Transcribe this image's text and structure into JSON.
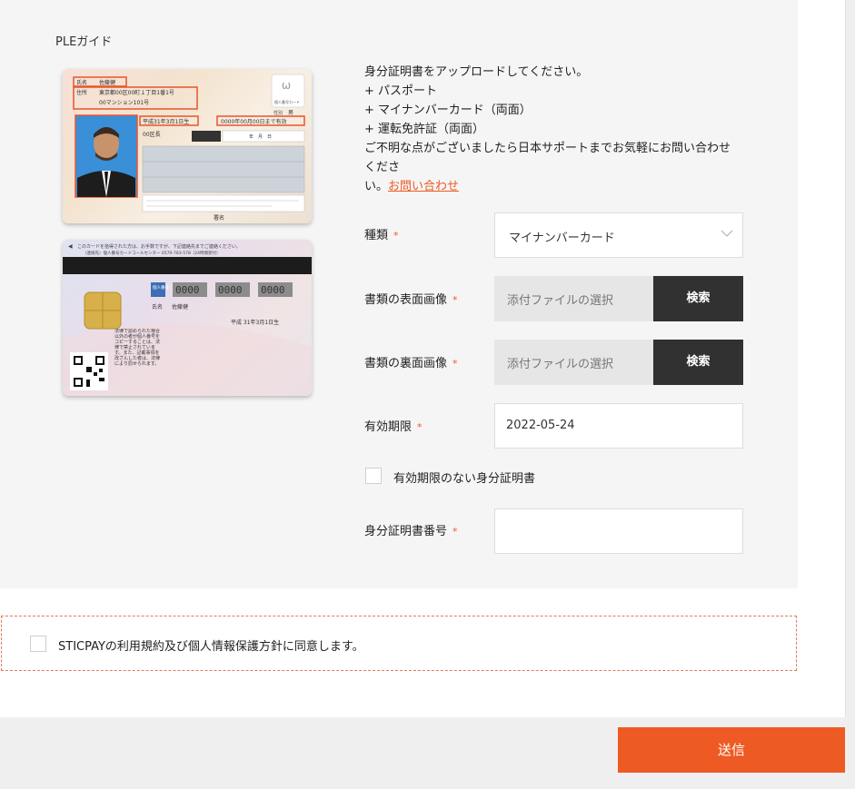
{
  "guide": {
    "title": "PLEガイド"
  },
  "card_front": {
    "name_label": "氏名",
    "name": "佐藤健",
    "address_label": "住所",
    "address_line1": "東京都00区00町１丁目1番1号",
    "address_line2": "00マンション101号",
    "birth": "平成31年3月1日生",
    "expiry": "0000年00月00日まで有効",
    "gender_label": "性別",
    "gender": "男",
    "ward": "00区長",
    "ym_d": "年　月　日",
    "signature": "署名",
    "mynumber_badge": "個人番号カード"
  },
  "card_back": {
    "notice": "このカードを拾得された方は、お手数ですが、下記連絡先までご連絡ください。",
    "contact": "（連絡先）個人番号カードコールセンター 0570-783-578（24時間受付）",
    "number_label": "個人番号",
    "number_blocks": [
      "0000",
      "0000",
      "0000"
    ],
    "name_label": "氏名",
    "name": "佐藤健",
    "birth": "平成 31年3月1日生",
    "legal_text": "法律で認められた場合以外の者が個人番号をコピーすることは、法律で禁止されています。また、記載事項を改ざんした者は、法律により罰せられます。"
  },
  "intro": {
    "line1": "身分証明書をアップロードしてください。",
    "line2": "+ パスポート",
    "line3": "+ マイナンバーカード（両面）",
    "line4": "+ 運転免許証（両面）",
    "line5": "ご不明な点がございましたら日本サポートまでお気軽にお問い合わせくださ",
    "line6_prefix": "い。",
    "contact_link": "お問い合わせ"
  },
  "form": {
    "required_mark": "*",
    "type_label": "種類",
    "type_value": "マイナンバーカード",
    "front_label": "書類の表面画像",
    "front_placeholder": "添付ファイルの選択",
    "front_button": "検索",
    "back_label": "書類の裏面画像",
    "back_placeholder": "添付ファイルの選択",
    "back_button": "検索",
    "expiry_label": "有効期限",
    "expiry_value": "2022-05-24",
    "no_expiry_label": "有効期限のない身分証明書",
    "id_number_label": "身分証明書番号",
    "id_number_value": ""
  },
  "agreement": {
    "label": "STICPAYの利用規約及び個人情報保護方針に同意します。"
  },
  "submit": {
    "label": "送信"
  },
  "colors": {
    "accent": "#ee5a24",
    "dark_button": "#313131",
    "panel": "#f5f5f5"
  }
}
